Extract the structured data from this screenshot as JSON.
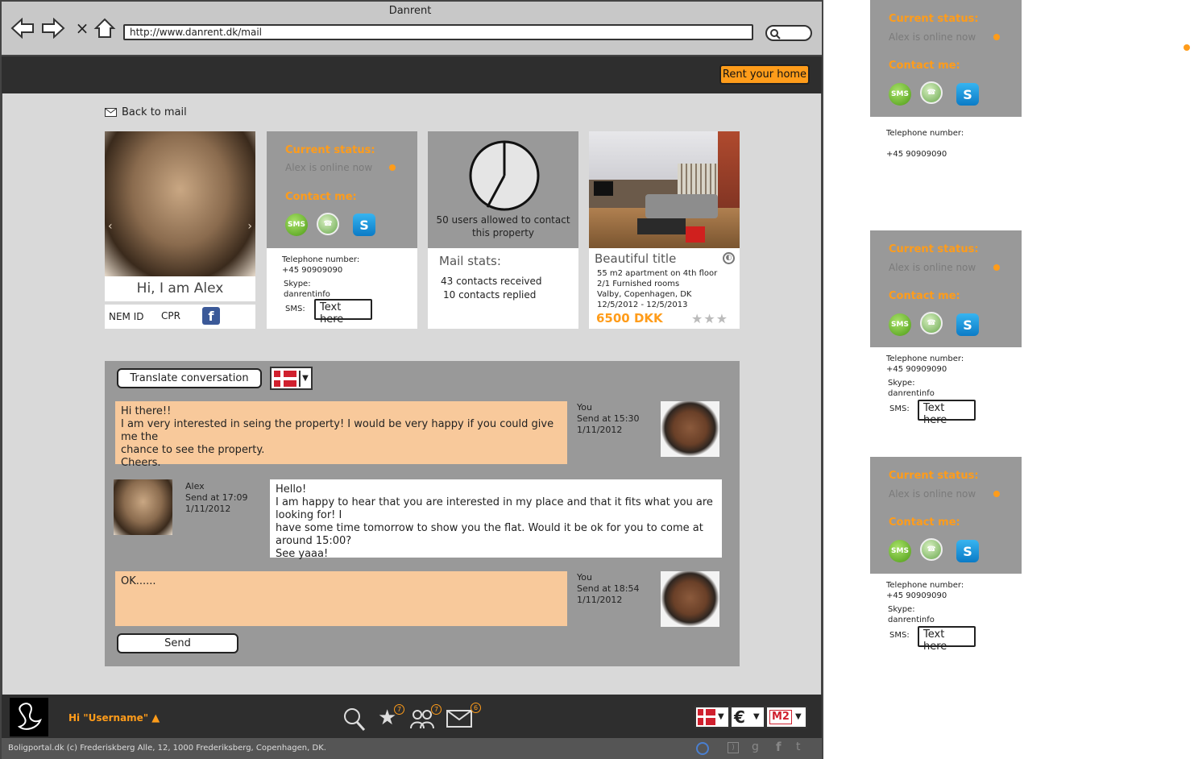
{
  "window": {
    "title": "Danrent"
  },
  "address_bar": {
    "url": "http://www.danrent.dk/mail"
  },
  "header": {
    "rent_button": "Rent your home"
  },
  "back_link": "Back to mail",
  "profile": {
    "greeting": "Hi, I am Alex",
    "nemid": "NEM ID",
    "cpr": "CPR"
  },
  "status_card": {
    "current_status_label": "Current status:",
    "status_text": "Alex is online now",
    "contact_label": "Contact me:",
    "sms_icon_text": "SMS",
    "telephone_label": "Telephone number:",
    "telephone": "+45 90909090",
    "skype_label": "Skype:",
    "skype": "danrentinfo",
    "sms_label": "SMS:",
    "sms_placeholder": "Text here"
  },
  "mail_stats": {
    "users_allowed": "50 users allowed to contact this property",
    "title": "Mail stats:",
    "received": "43 contacts received",
    "replied": "10 contacts replied"
  },
  "property": {
    "title": "Beautiful title",
    "line1": "55 m2 apartment on 4th floor",
    "line2": "2/1 Furnished rooms",
    "line3": "Valby, Copenhagen, DK",
    "dates": "12/5/2012 - 12/5/2013",
    "price": "6500 DKK"
  },
  "chat": {
    "translate_button": "Translate conversation",
    "messages": [
      {
        "who": "You",
        "sent": "Send at 15:30",
        "date": "1/11/2012",
        "lines": [
          "Hi there!!",
          "I am very interested in seing the property! I would be very happy if you could give me the",
          "chance to see the property.",
          "Cheers."
        ]
      },
      {
        "who": "Alex",
        "sent": "Send at 17:09",
        "date": "1/11/2012",
        "lines": [
          "Hello!",
          "I am happy to hear that you are interested in my place and that it fits what you are looking for! I",
          "have some time tomorrow to show you the flat. Would it be ok for you to come at around 15:00?",
          "See yaaa!"
        ]
      },
      {
        "who": "You",
        "sent": "Send at 18:54",
        "date": "1/11/2012",
        "lines": [
          "OK......"
        ]
      }
    ],
    "send_button": "Send"
  },
  "footer": {
    "greeting": "Hi \"Username\"",
    "badge_favorites": "7",
    "badge_groups": "7",
    "badge_mail": "6",
    "unit_label": "M2",
    "copyright": "Boligportal.dk (c) Frederiskberg Alle, 12, 1000 Frederiksberg, Copenhagen, DK."
  },
  "side_cards": {
    "current_status_label": "Current status:",
    "status_text": "Alex is online now",
    "contact_label": "Contact me:",
    "telephone_label": "Telephone number:",
    "telephone": "+45 90909090",
    "skype_label": "Skype:",
    "skype": "danrentinfo",
    "sms_label": "SMS:",
    "sms_placeholder": "Text here"
  },
  "colors": {
    "accent": "#ff9c1a",
    "dark": "#2e2e2e",
    "panel_gray": "#999999",
    "bubble": "#f8c99b"
  }
}
